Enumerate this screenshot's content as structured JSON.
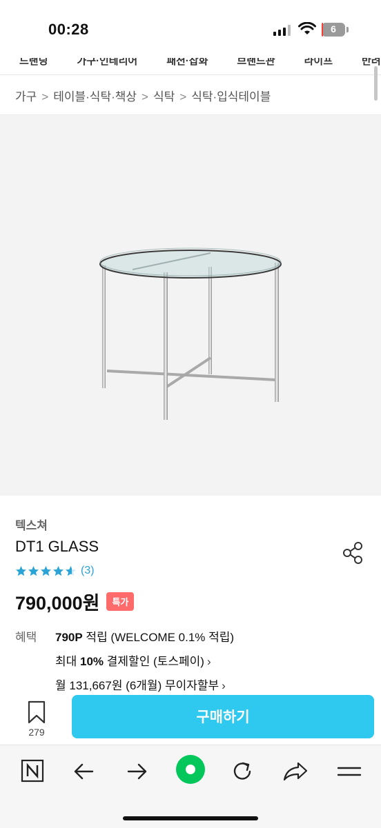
{
  "status_bar": {
    "time": "00:28",
    "battery": "6",
    "battery_level": 0.06
  },
  "menu_strip": {
    "items": [
      "드랜딩",
      "가구·인테리어",
      "패션·잡화",
      "브랜드관",
      "라이프",
      "반려생활"
    ]
  },
  "breadcrumb": [
    "가구",
    "테이블·식탁·책상",
    "식탁",
    "식탁·입식테이블"
  ],
  "product": {
    "brand": "텍스쳐",
    "name": "DT1 GLASS",
    "rating": 4.6,
    "review_count": "(3)",
    "price": "790,000원",
    "badge": "특가"
  },
  "benefits": {
    "label": "혜택",
    "line1_bold": "790P",
    "line1_rest": " 적립 (WELCOME 0.1% 적립)",
    "line2_pre": "최대 ",
    "line2_bold": "10%",
    "line2_rest": " 결제할인 (토스페이)",
    "line3": "월 131,667원 (6개월) 무이자할부",
    "chevron": "›"
  },
  "action_bar": {
    "bookmark_count": "279",
    "buy_label": "구매하기"
  },
  "browser_bar": {
    "icons": [
      "naver-icon",
      "back-icon",
      "forward-icon",
      "green-dot-icon",
      "refresh-icon",
      "share-icon",
      "menu-icon"
    ]
  },
  "colors": {
    "accent": "#2fc8ef",
    "badge": "#ff6b6b",
    "star": "#2aa3d6",
    "green": "#03c75a"
  }
}
